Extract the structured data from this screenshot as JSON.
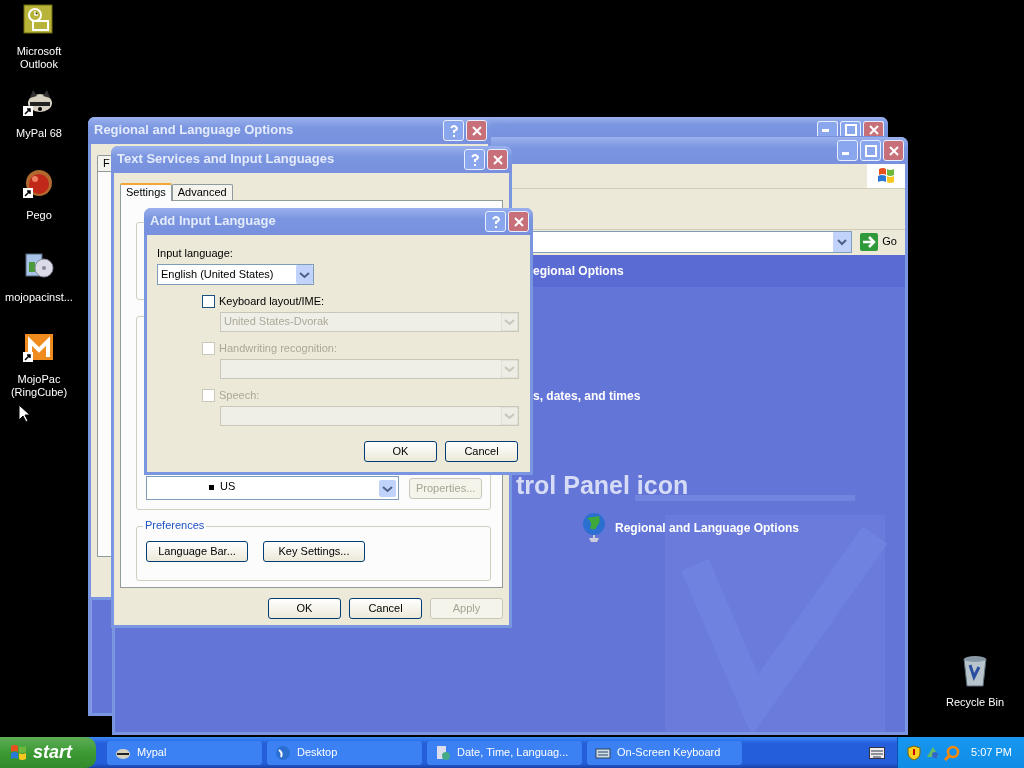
{
  "desktop_icons": [
    {
      "label": "Microsoft Outlook",
      "kind": "mail",
      "shortcut": false
    },
    {
      "label": "MyPal 68",
      "kind": "raccoon",
      "shortcut": true
    },
    {
      "label": "Pego",
      "kind": "ball",
      "shortcut": true
    },
    {
      "label": "mojopacinst...",
      "kind": "installer",
      "shortcut": false
    },
    {
      "label": "MojoPac (RingCube)",
      "kind": "letter",
      "shortcut": true
    }
  ],
  "recycle_bin": {
    "label": "Recycle Bin"
  },
  "control_panel": {
    "go_button": "Go",
    "header": "egional Options",
    "section_text": "s, dates, and times",
    "heading": "trol Panel icon",
    "link": "Regional and Language Options"
  },
  "regional_dialog": {
    "title": "Regional and Language Options",
    "tab": "F"
  },
  "text_services_dialog": {
    "title": "Text Services and Input Languages",
    "tabs": [
      {
        "label": "Settings",
        "selected": true
      },
      {
        "label": "Advanced",
        "selected": false
      }
    ],
    "list_item": "US",
    "properties_button": {
      "label": "Properties...",
      "disabled": true
    },
    "preferences_legend": "Preferences",
    "preferences_buttons": [
      "Language Bar...",
      "Key Settings..."
    ],
    "buttons": [
      {
        "label": "OK",
        "disabled": false
      },
      {
        "label": "Cancel",
        "disabled": false
      },
      {
        "label": "Apply",
        "disabled": true
      }
    ]
  },
  "add_input_language_dialog": {
    "title": "Add Input Language",
    "input_language_label": "Input language:",
    "input_language": "English (United States)",
    "options": [
      {
        "label": "Keyboard layout/IME:",
        "checked": false,
        "disabled": false,
        "value": "United States-Dvorak"
      },
      {
        "label": "Handwriting recognition:",
        "checked": false,
        "disabled": true
      },
      {
        "label": "Speech:",
        "checked": false,
        "disabled": true
      }
    ],
    "buttons": [
      "OK",
      "Cancel"
    ]
  },
  "taskbar": {
    "start": "start",
    "items": [
      {
        "label": "Mypal",
        "kind": "raccoon"
      },
      {
        "label": "Desktop",
        "kind": "browser"
      },
      {
        "label": "Date, Time, Languag...",
        "kind": "settings"
      },
      {
        "label": "On-Screen Keyboard",
        "kind": "keyboard"
      }
    ],
    "clock": "5:07 PM"
  }
}
